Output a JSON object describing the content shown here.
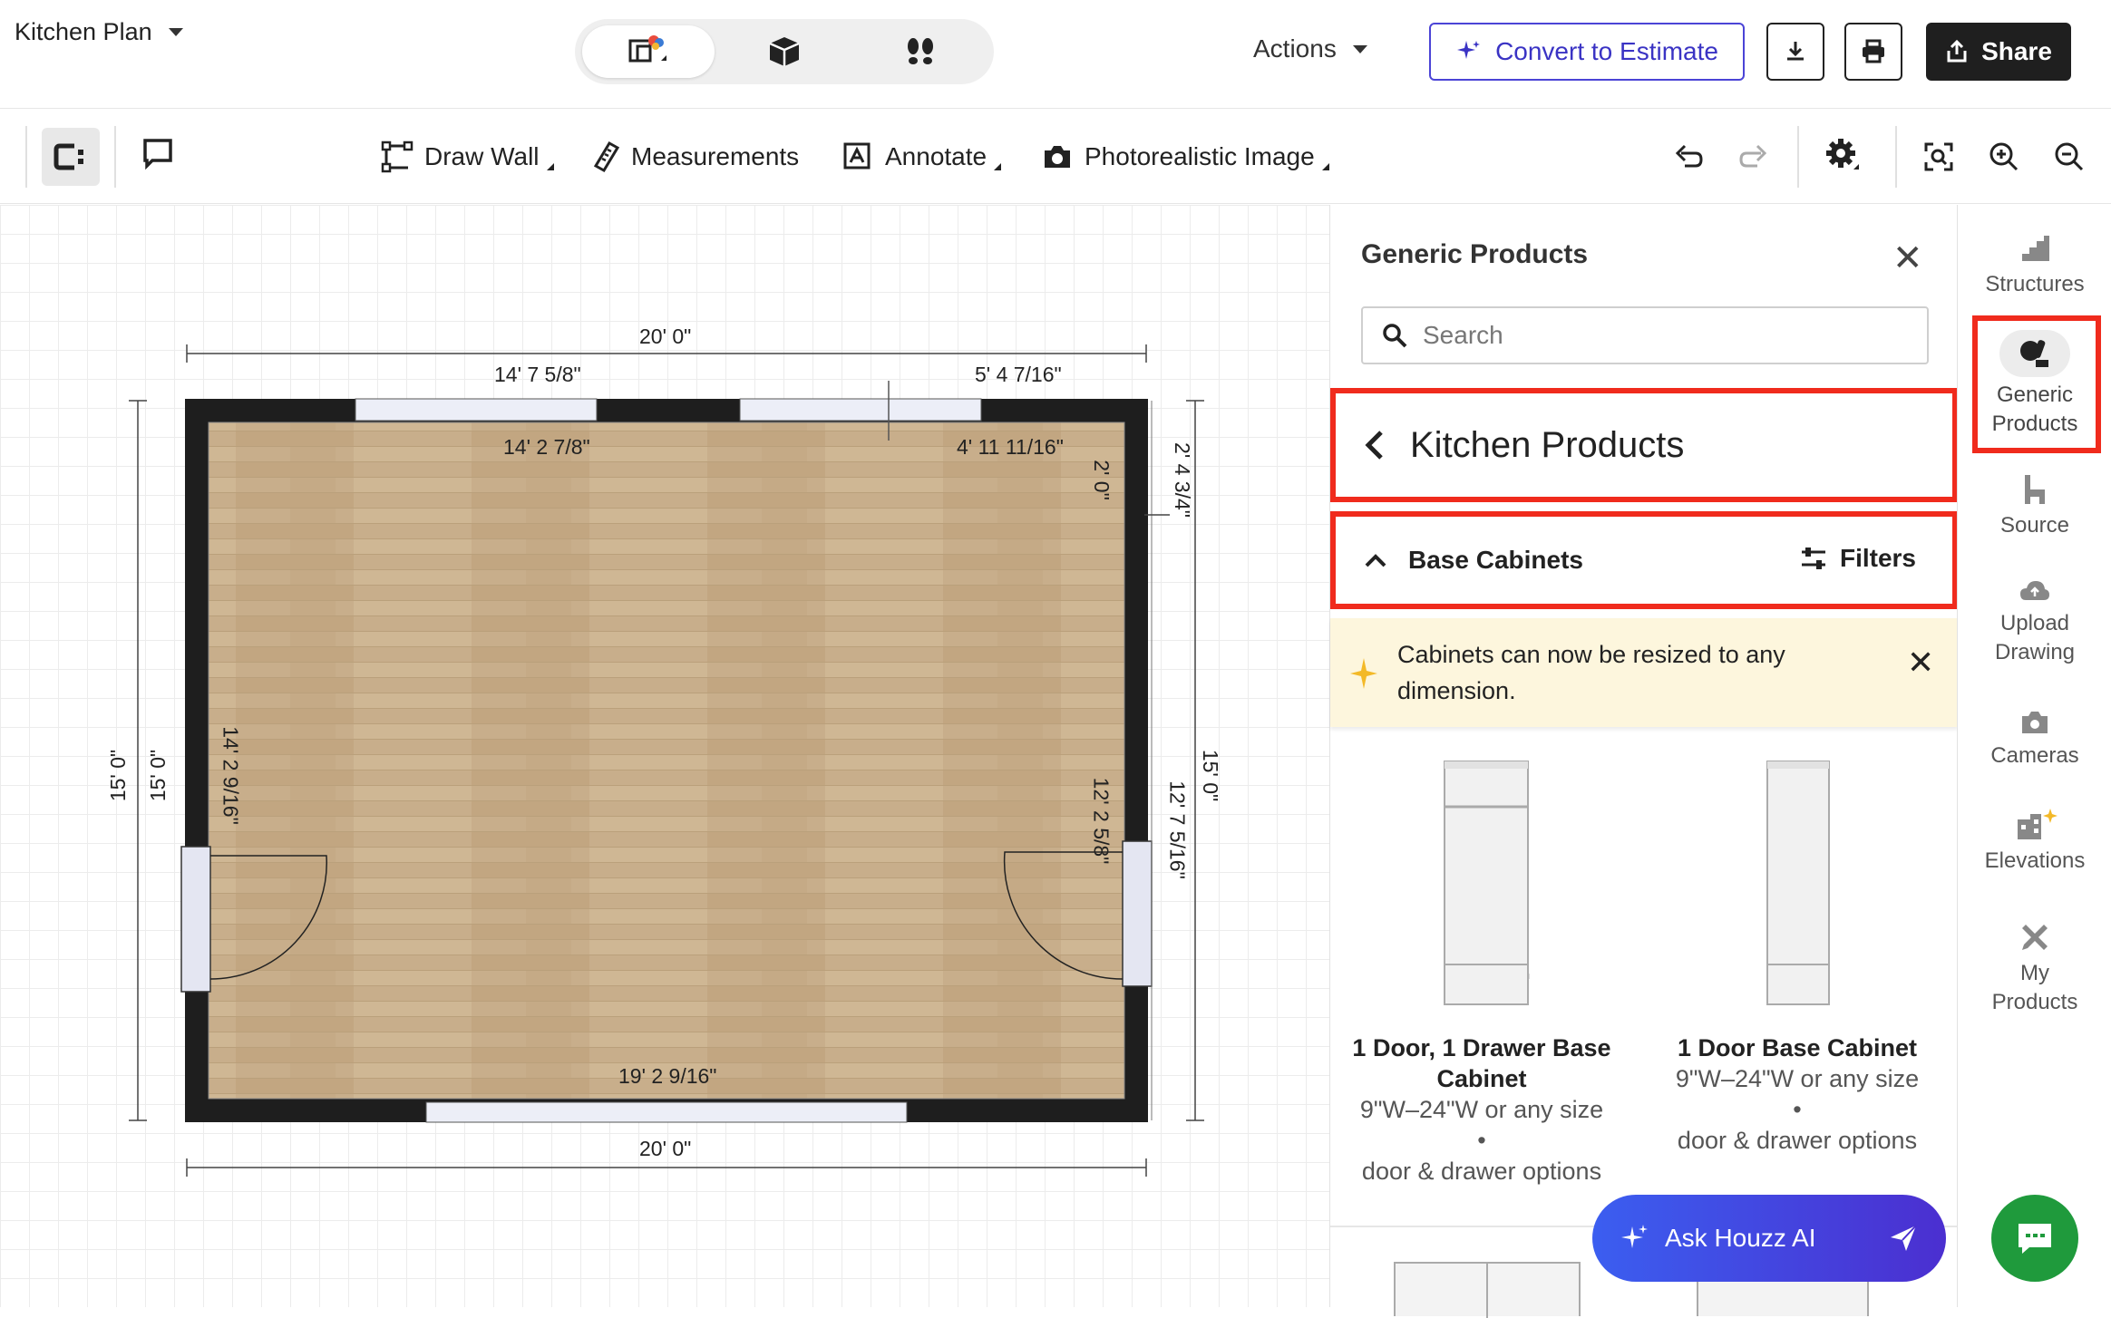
{
  "header": {
    "plan_title": "Kitchen Plan",
    "actions_label": "Actions",
    "convert_label": "Convert to Estimate",
    "share_label": "Share"
  },
  "view_modes": [
    "2d-plan-icon",
    "3d-box-icon",
    "walkthrough-footsteps-icon"
  ],
  "toolbar": {
    "draw_wall": "Draw Wall",
    "measurements": "Measurements",
    "annotate": "Annotate",
    "photo_image": "Photorealistic Image"
  },
  "floorplan": {
    "top_total": "20' 0\"",
    "top_left": "14' 7 5/8\"",
    "top_right": "5' 4 7/16\"",
    "inner_top_left": "14' 2 7/8\"",
    "inner_top_right": "4' 11 11/16\"",
    "right_small": "2' 0\"",
    "right_outer_top": "2' 4 3/4\"",
    "left_outer_1": "15' 0\"",
    "left_outer_2": "15' 0\"",
    "left_inner": "14' 2 9/16\"",
    "right_inner": "12' 2 5/8\"",
    "right_outer_mid": "12' 7 5/16\"",
    "right_outer_full": "15' 0\"",
    "bottom_inner": "19' 2 9/16\"",
    "bottom_total": "20' 0\"",
    "floor_color": "#c9b08e",
    "wall_color": "#1e1e1e"
  },
  "panel": {
    "title": "Generic Products",
    "search_placeholder": "Search",
    "category": "Kitchen Products",
    "subcategory": "Base Cabinets",
    "filters_label": "Filters",
    "notice": "Cabinets can now be resized to any dimension.",
    "products": [
      {
        "name": "1 Door, 1 Drawer Base Cabinet",
        "size": "9\"W–24\"W or any size",
        "dot": "•",
        "options": "door & drawer options"
      },
      {
        "name": "1 Door Base Cabinet",
        "size": "9\"W–24\"W or any size",
        "dot": "•",
        "options": "door & drawer options"
      }
    ]
  },
  "rail": {
    "items": [
      {
        "label": "Structures"
      },
      {
        "label": "Generic Products"
      },
      {
        "label": "Source"
      },
      {
        "label": "Upload Drawing"
      },
      {
        "label": "Cameras"
      },
      {
        "label": "Elevations"
      },
      {
        "label": "My Products"
      }
    ]
  },
  "ask_ai": {
    "label": "Ask Houzz AI"
  },
  "colors": {
    "accent": "#4b44d6",
    "highlight": "#f02b1d",
    "notice_bg": "#fdf6dd",
    "chat_green": "#1f9a3c"
  }
}
